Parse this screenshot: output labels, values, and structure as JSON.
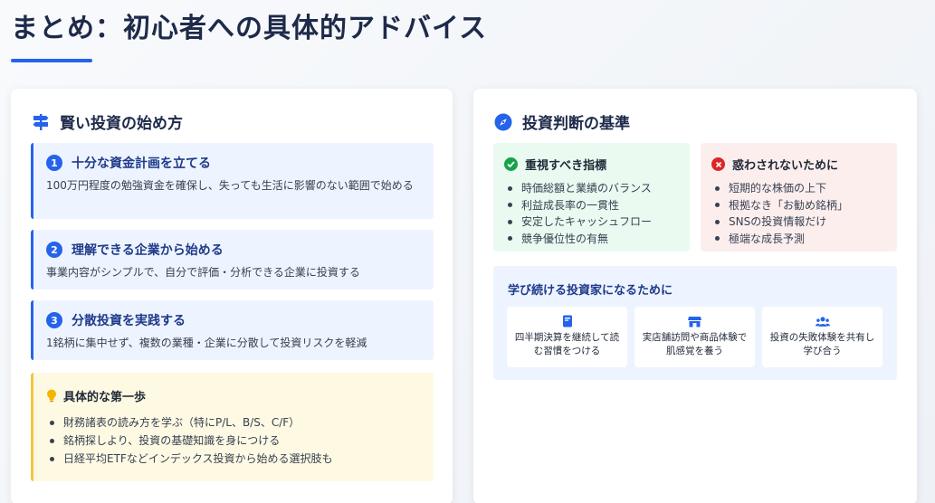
{
  "page": {
    "title": "まとめ：初心者への具体的アドバイス"
  },
  "colors": {
    "accent": "#2563eb",
    "good": "#16a34a",
    "bad": "#dc2626",
    "tip": "#f4c542"
  },
  "left_card": {
    "icon": "signpost-icon",
    "heading": "賢い投資の始め方",
    "steps": [
      {
        "num": "1",
        "title": "十分な資金計画を立てる",
        "desc": "100万円程度の勉強資金を確保し、失っても生活に影響のない範囲で始める"
      },
      {
        "num": "2",
        "title": "理解できる企業から始める",
        "desc": "事業内容がシンプルで、自分で評価・分析できる企業に投資する"
      },
      {
        "num": "3",
        "title": "分散投資を実践する",
        "desc": "1銘柄に集中せず、複数の業種・企業に分散して投資リスクを軽減"
      }
    ],
    "tip": {
      "icon": "lightbulb-icon",
      "title": "具体的な第一歩",
      "items": [
        "財務諸表の読み方を学ぶ（特にP/L、B/S、C/F）",
        "銘柄探しより、投資の基礎知識を身につける",
        "日経平均ETFなどインデックス投資から始める選択肢も"
      ]
    }
  },
  "right_card": {
    "icon": "compass-icon",
    "heading": "投資判断の基準",
    "good": {
      "icon": "check-circle-icon",
      "title": "重視すべき指標",
      "items": [
        "時価総額と業績のバランス",
        "利益成長率の一貫性",
        "安定したキャッシュフロー",
        "競争優位性の有無"
      ]
    },
    "bad": {
      "icon": "x-circle-icon",
      "title": "惑わされないために",
      "items": [
        "短期的な株価の上下",
        "根拠なき「お勧め銘柄」",
        "SNSの投資情報だけ",
        "極端な成長予測"
      ]
    },
    "learn": {
      "title": "学び続ける投資家になるために",
      "items": [
        {
          "icon": "book-icon",
          "text": "四半期決算を継続して読む習慣をつける"
        },
        {
          "icon": "store-icon",
          "text": "実店舗訪問や商品体験で肌感覚を養う"
        },
        {
          "icon": "users-icon",
          "text": "投資の失敗体験を共有し学び合う"
        }
      ]
    }
  }
}
